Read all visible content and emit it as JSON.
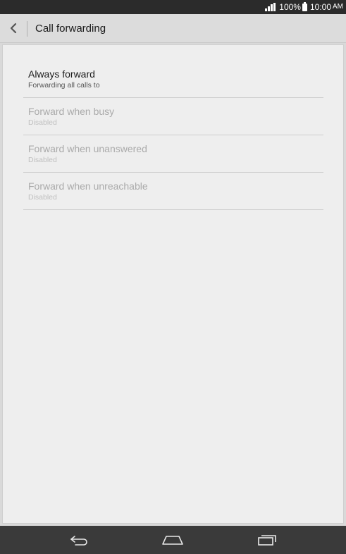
{
  "status_bar": {
    "battery_percent": "100%",
    "time": "10:00",
    "ampm": "AM",
    "icons": [
      "signal-icon",
      "battery-icon"
    ]
  },
  "action_bar": {
    "title": "Call forwarding",
    "back_icon": "chevron-left-icon"
  },
  "settings": {
    "items": [
      {
        "primary": "Always forward",
        "secondary": "Forwarding all calls to",
        "enabled": true
      },
      {
        "primary": "Forward when busy",
        "secondary": "Disabled",
        "enabled": false
      },
      {
        "primary": "Forward when unanswered",
        "secondary": "Disabled",
        "enabled": false
      },
      {
        "primary": "Forward when unreachable",
        "secondary": "Disabled",
        "enabled": false
      }
    ]
  },
  "nav_bar": {
    "icons": [
      "back-icon",
      "home-icon",
      "recent-apps-icon"
    ]
  },
  "colors": {
    "status_bar_bg": "#2b2b2b",
    "action_bar_bg": "#dcdcdc",
    "content_bg": "#eeeeee",
    "nav_bar_bg": "#3a3a3a",
    "disabled_text": "#aaaaaa"
  }
}
